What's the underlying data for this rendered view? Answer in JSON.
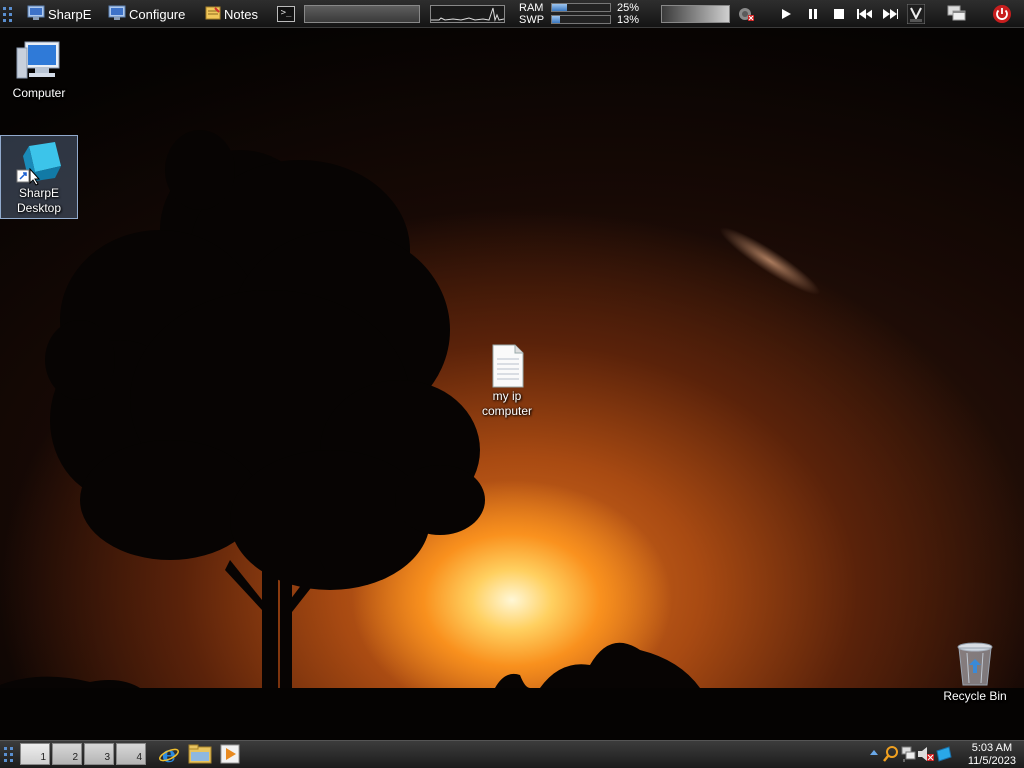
{
  "top_panel": {
    "apps": [
      {
        "label": "SharpE",
        "icon": "monitor-icon"
      },
      {
        "label": "Configure",
        "icon": "monitor-icon"
      },
      {
        "label": "Notes",
        "icon": "notes-icon"
      }
    ],
    "terminal_icon": ">_",
    "ram": {
      "label": "RAM",
      "percent_text": "25%",
      "percent": 25
    },
    "swp": {
      "label": "SWP",
      "percent_text": "13%",
      "percent": 13
    },
    "media_controls": [
      "play-icon",
      "pause-icon",
      "stop-icon",
      "previous-icon",
      "next-icon"
    ]
  },
  "desktop": {
    "icons": [
      {
        "label": "Computer",
        "icon": "computer-icon"
      },
      {
        "label": "SharpE Desktop",
        "icon": "sharpe-desktop-shortcut-icon",
        "selected": true
      },
      {
        "label": "my ip computer",
        "icon": "text-document-icon"
      },
      {
        "label": "Recycle Bin",
        "icon": "recycle-bin-icon"
      }
    ]
  },
  "taskbar": {
    "workspaces": [
      "1",
      "2",
      "3",
      "4"
    ],
    "active_workspace": "1",
    "quicklaunch": [
      "internet-explorer-icon",
      "file-explorer-icon",
      "media-player-icon"
    ],
    "clock": {
      "time": "5:03 AM",
      "date": "11/5/2023"
    }
  },
  "colors": {
    "accent_power": "#e02020",
    "selection": "#7896be"
  }
}
